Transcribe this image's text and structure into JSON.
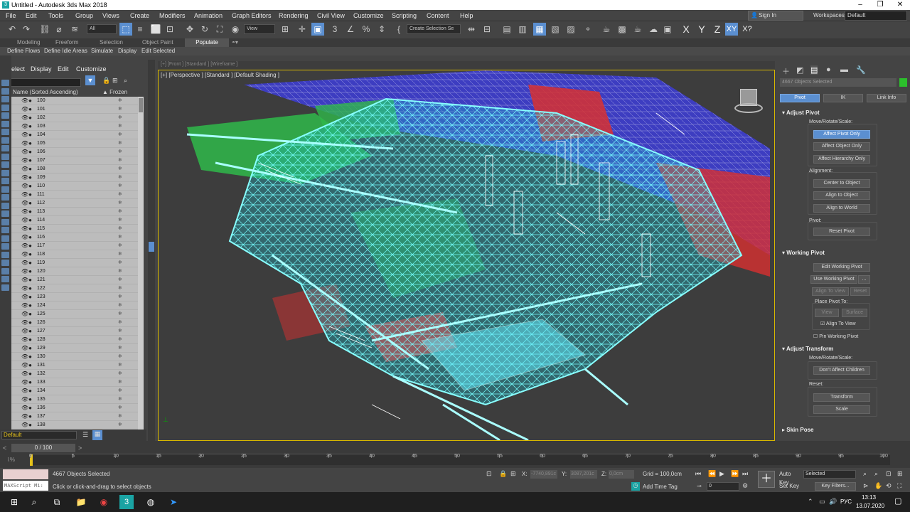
{
  "window": {
    "title": "Untitled - Autodesk 3ds Max 2018",
    "app_icon": "3"
  },
  "menu": [
    "File",
    "Edit",
    "Tools",
    "Group",
    "Views",
    "Create",
    "Modifiers",
    "Animation",
    "Graph Editors",
    "Rendering",
    "Civil View",
    "Customize",
    "Scripting",
    "Content",
    "Help"
  ],
  "signin": "Sign In",
  "workspaces_label": "Workspaces:",
  "workspace": "Default",
  "toolbar": {
    "filter": "All",
    "view": "View",
    "create_selection": "Create Selection Se",
    "axes": [
      "X",
      "Y",
      "Z",
      "XY",
      "X?"
    ]
  },
  "ribbon_tabs": [
    "Modeling",
    "Freeform",
    "Selection",
    "Object Paint",
    "Populate"
  ],
  "ribbon_items": [
    "Define Flows",
    "Define Idle Areas",
    "Simulate",
    "Display",
    "Edit Selected"
  ],
  "scene": {
    "tabs": [
      "Select",
      "Display",
      "Edit",
      "Customize"
    ],
    "col_name": "Name (Sorted Ascending)",
    "col_frozen": "▲ Frozen",
    "rows": [
      "100",
      "101",
      "102",
      "103",
      "104",
      "105",
      "106",
      "107",
      "108",
      "109",
      "110",
      "111",
      "112",
      "113",
      "114",
      "115",
      "116",
      "117",
      "118",
      "119",
      "120",
      "121",
      "122",
      "123",
      "124",
      "125",
      "126",
      "127",
      "128",
      "129",
      "130",
      "131",
      "132",
      "133",
      "134",
      "135",
      "136",
      "137",
      "138"
    ],
    "layer": "Default"
  },
  "viewport": {
    "label": "[+] [Perspective ] [Standard ] [Default Shading ]",
    "behind": "[+] [Front ] [Standard ] [Wireframe ]"
  },
  "cmd": {
    "selected": "4667 Objects Selected",
    "tabs": [
      "Pivot",
      "IK",
      "Link Info"
    ],
    "adjust_pivot": "Adjust Pivot",
    "move_rotate_scale": "Move/Rotate/Scale:",
    "affect_pivot": "Affect Pivot Only",
    "affect_object": "Affect Object Only",
    "affect_hierarchy": "Affect Hierarchy Only",
    "alignment": "Alignment:",
    "center": "Center to Object",
    "align_obj": "Align to Object",
    "align_world": "Align to World",
    "pivot": "Pivot:",
    "reset_pivot": "Reset Pivot",
    "working_pivot": "Working Pivot",
    "edit_wp": "Edit Working Pivot",
    "use_wp": "Use Working Pivot",
    "dots": "...",
    "align_view": "Align To View",
    "reset": "Reset",
    "place_pivot": "Place Pivot To:",
    "view": "View",
    "surface": "Surface",
    "align_to_view": "Align To View",
    "pin_wp": "Pin Working Pivot",
    "adjust_transform": "Adjust Transform",
    "mrs2": "Move/Rotate/Scale:",
    "dont_affect": "Don't Affect Children",
    "reset_lbl": "Reset:",
    "transform": "Transform",
    "scale": "Scale",
    "skin_pose": "Skin Pose"
  },
  "time": {
    "frame": "0 / 100",
    "ticks": [
      "0",
      "5",
      "10",
      "15",
      "20",
      "25",
      "30",
      "35",
      "40",
      "45",
      "50",
      "55",
      "60",
      "65",
      "70",
      "75",
      "80",
      "85",
      "90",
      "95",
      "100"
    ]
  },
  "status": {
    "maxscript": "MAXScript Mi:",
    "selected": "4667 Objects Selected",
    "prompt": "Click or click-and-drag to select objects",
    "x_label": "X:",
    "x": "-7740,891c",
    "y_label": "Y:",
    "y": "3087,201c",
    "z_label": "Z:",
    "z": "0,0cm",
    "grid": "Grid = 100,0cm",
    "add_time_tag": "Add Time Tag",
    "auto_key": "Auto Key",
    "key_mode": "Selected",
    "set_key": "Set Key",
    "key_filters": "Key Filters...",
    "frame_value": "0"
  },
  "taskbar": {
    "lang": "РУС",
    "time": "13:13",
    "date": "13.07.2020"
  }
}
